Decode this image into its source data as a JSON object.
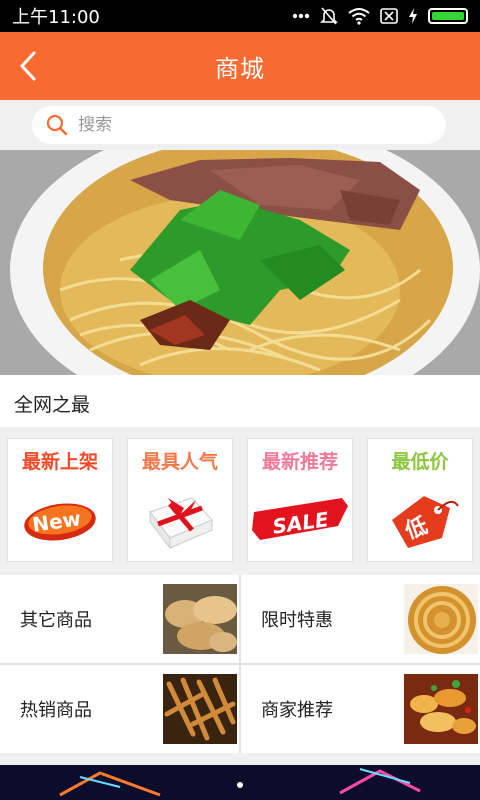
{
  "status_bar": {
    "time": "上午11:00",
    "icons": [
      "dots-icon",
      "mute-icon",
      "wifi-icon",
      "sim-icon",
      "charging-icon",
      "battery-icon"
    ],
    "battery_level": 1.0
  },
  "app_bar": {
    "title": "商城",
    "back_icon": "chevron-left-icon",
    "color": "#f56b32"
  },
  "search": {
    "placeholder": "搜索",
    "icon": "search-icon",
    "accent": "#f56b32"
  },
  "banner": {
    "subject": "beef noodle soup photo"
  },
  "section": {
    "title": "全网之最"
  },
  "promos": [
    {
      "label": "最新上架",
      "color": "#f04a2a",
      "badge": "New"
    },
    {
      "label": "最具人气",
      "color": "#ef7a4e"
    },
    {
      "label": "最新推荐",
      "color": "#f07a9a",
      "badge": "SALE"
    },
    {
      "label": "最低价",
      "color": "#8cc63f",
      "badge": "低"
    }
  ],
  "categories": [
    {
      "label": "其它商品"
    },
    {
      "label": "限时特惠"
    },
    {
      "label": "热销商品"
    },
    {
      "label": "商家推荐"
    }
  ]
}
